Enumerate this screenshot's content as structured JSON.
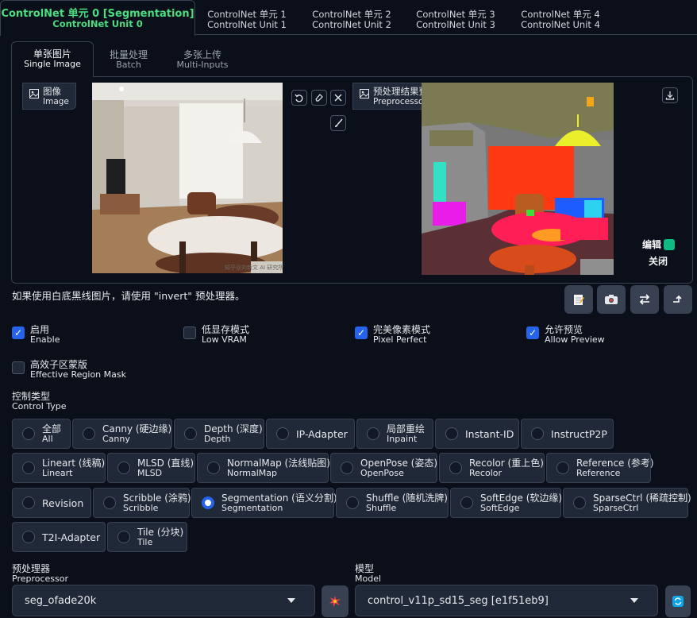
{
  "unit_tabs": [
    {
      "cn": "ControlNet 单元 0 [Segmentation]",
      "en": "ControlNet Unit 0"
    },
    {
      "cn": "ControlNet 单元 1",
      "en": "ControlNet Unit 1"
    },
    {
      "cn": "ControlNet 单元 2",
      "en": "ControlNet Unit 2"
    },
    {
      "cn": "ControlNet 单元 3",
      "en": "ControlNet Unit 3"
    },
    {
      "cn": "ControlNet 单元 4",
      "en": "ControlNet Unit 4"
    }
  ],
  "mode_tabs": [
    {
      "cn": "单张图片",
      "en": "Single Image"
    },
    {
      "cn": "批量处理",
      "en": "Batch"
    },
    {
      "cn": "多张上传",
      "en": "Multi-Inputs"
    }
  ],
  "image_panel": {
    "cn": "图像",
    "en": "Image",
    "icon": "image-icon",
    "watermark": "知乎@刘新文 AI 研究所"
  },
  "preview_panel": {
    "cn": "预处理结果预览",
    "en": "Preprocessor Preview",
    "icon": "image-icon",
    "edit_label": "编辑",
    "close_label": "关闭"
  },
  "image_tools": [
    "undo-icon",
    "eraser-icon",
    "close-icon",
    "brush-icon"
  ],
  "hint": "如果使用白底黑线图片，请使用 \"invert\" 预处理器。",
  "action_buttons": [
    "notepad-icon",
    "camera-icon",
    "swap-icon",
    "send-dimensions-icon"
  ],
  "options": [
    {
      "cn": "启用",
      "en": "Enable",
      "checked": true
    },
    {
      "cn": "低显存模式",
      "en": "Low VRAM",
      "checked": false
    },
    {
      "cn": "完美像素模式",
      "en": "Pixel Perfect",
      "checked": true
    },
    {
      "cn": "允许预览",
      "en": "Allow Preview",
      "checked": true
    },
    {
      "cn": "高效子区蒙版",
      "en": "Effective Region Mask",
      "checked": false
    }
  ],
  "control_type": {
    "cn": "控制类型",
    "en": "Control Type",
    "selected": "Segmentation",
    "options": [
      {
        "cn": "全部",
        "en": "All"
      },
      {
        "cn": "Canny (硬边缘)",
        "en": "Canny"
      },
      {
        "cn": "Depth (深度)",
        "en": "Depth"
      },
      {
        "cn": "IP-Adapter",
        "en": ""
      },
      {
        "cn": "局部重绘",
        "en": "Inpaint"
      },
      {
        "cn": "Instant-ID",
        "en": ""
      },
      {
        "cn": "InstructP2P",
        "en": ""
      },
      {
        "cn": "Lineart (线稿)",
        "en": "Lineart"
      },
      {
        "cn": "MLSD (直线)",
        "en": "MLSD"
      },
      {
        "cn": "NormalMap (法线贴图)",
        "en": "NormalMap"
      },
      {
        "cn": "OpenPose (姿态)",
        "en": "OpenPose"
      },
      {
        "cn": "Recolor (重上色)",
        "en": "Recolor"
      },
      {
        "cn": "Reference (参考)",
        "en": "Reference"
      },
      {
        "cn": "Revision",
        "en": ""
      },
      {
        "cn": "Scribble (涂鸦)",
        "en": "Scribble"
      },
      {
        "cn": "Segmentation (语义分割)",
        "en": "Segmentation"
      },
      {
        "cn": "Shuffle (随机洗牌)",
        "en": "Shuffle"
      },
      {
        "cn": "SoftEdge (软边缘)",
        "en": "SoftEdge"
      },
      {
        "cn": "SparseCtrl (稀疏控制)",
        "en": "SparseCtrl"
      },
      {
        "cn": "T2I-Adapter",
        "en": ""
      },
      {
        "cn": "Tile (分块)",
        "en": "Tile"
      }
    ]
  },
  "preprocessor": {
    "cn": "预处理器",
    "en": "Preprocessor",
    "value": "seg_ofade20k",
    "run_icon": "explosion-icon"
  },
  "model": {
    "cn": "模型",
    "en": "Model",
    "value": "control_v11p_sd15_seg [e1f51eb9]",
    "refresh_icon": "refresh-icon"
  }
}
